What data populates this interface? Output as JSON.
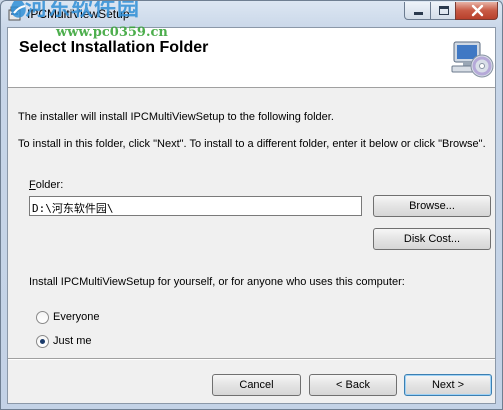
{
  "window": {
    "title": "IPCMultiViewSetup"
  },
  "watermark": {
    "site_name": "河东软件园",
    "url": "www.pc0359.cn"
  },
  "banner": {
    "title": "Select Installation Folder"
  },
  "body": {
    "line1": "The installer will install IPCMultiViewSetup to the following folder.",
    "line2": "To install in this folder, click \"Next\". To install to a different folder, enter it below or click \"Browse\"."
  },
  "folder": {
    "label_first": "F",
    "label_rest": "older:",
    "value": "D:\\河东软件园\\"
  },
  "buttons": {
    "browse": "Browse...",
    "disk_cost": "Disk Cost...",
    "cancel": "Cancel",
    "back": "< Back",
    "next": "Next >"
  },
  "install_for": {
    "prompt": "Install IPCMultiViewSetup for yourself, or for anyone who uses this computer:",
    "options": [
      {
        "label": "Everyone",
        "selected": false
      },
      {
        "label": "Just me",
        "selected": true
      }
    ]
  },
  "icons": {
    "app": "installer-icon",
    "banner": "computer-cd-icon",
    "minimize": "minimize-icon",
    "maximize": "maximize-icon",
    "close": "close-icon"
  },
  "colors": {
    "title_bar": "#c8d6e8",
    "close_button": "#c85a45",
    "watermark_blue": "#2f8fd6",
    "watermark_green": "#3aa63a",
    "default_button_border": "#3c7fb1"
  }
}
